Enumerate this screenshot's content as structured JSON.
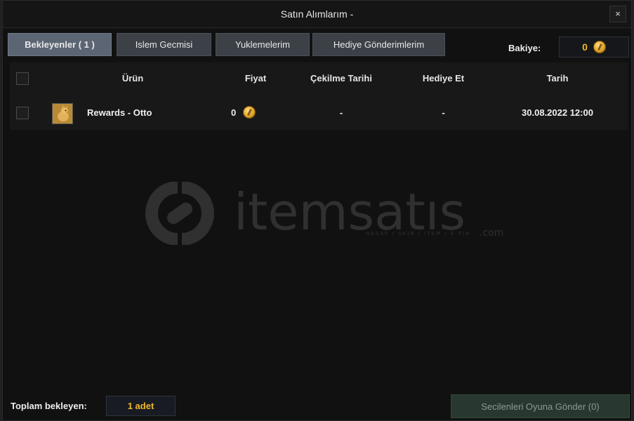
{
  "window": {
    "title": "Satın Alımlarım -",
    "close_label": "×"
  },
  "tabs": [
    {
      "label": "Bekleyenler ( 1 )",
      "active": true
    },
    {
      "label": "Islem Gecmisi",
      "active": false
    },
    {
      "label": "Yuklemelerim",
      "active": false
    },
    {
      "label": "Hediye Gönderimlerim",
      "active": false
    }
  ],
  "balance": {
    "label": "Bakiye:",
    "value": "0",
    "icon": "gold-coin-icon"
  },
  "table": {
    "headers": {
      "product": "Ürün",
      "price": "Fiyat",
      "withdraw_date": "Çekilme Tarihi",
      "gift": "Hediye Et",
      "date": "Tarih"
    },
    "rows": [
      {
        "product": "Rewards - Otto",
        "price": "0",
        "withdraw_date": "-",
        "gift": "-",
        "date": "30.08.2022 12:00",
        "icon": "otto-item-icon"
      }
    ]
  },
  "watermark": {
    "brand": "itemsatıs",
    "tagline": "HESAP / SKIN / ITEM / E-PIN",
    "suffix": ".com"
  },
  "footer": {
    "pending_label": "Toplam bekleyen:",
    "pending_count": "1 adet",
    "send_button": "Secilenleri Oyuna Gönder (0)"
  },
  "colors": {
    "accent_gold": "#f0b92c",
    "tab_active": "#5b6573",
    "tab": "#3c4148",
    "send_button_bg": "#283830"
  }
}
